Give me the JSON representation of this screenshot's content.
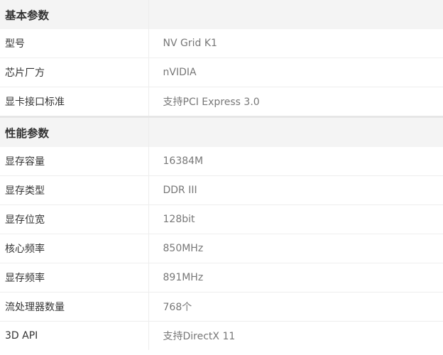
{
  "sections": [
    {
      "title": "基本参数",
      "rows": [
        {
          "label": "型号",
          "value": "NV Grid K1"
        },
        {
          "label": "芯片厂方",
          "value": "nVIDIA"
        },
        {
          "label": "显卡接口标准",
          "value": "支持PCI Express 3.0"
        }
      ]
    },
    {
      "title": "性能参数",
      "rows": [
        {
          "label": "显存容量",
          "value": "16384M"
        },
        {
          "label": "显存类型",
          "value": "DDR III"
        },
        {
          "label": "显存位宽",
          "value": "128bit"
        },
        {
          "label": "核心频率",
          "value": "850MHz"
        },
        {
          "label": "显存频率",
          "value": "891MHz"
        },
        {
          "label": "流处理器数量",
          "value": "768个"
        },
        {
          "label": "3D API",
          "value": "支持DirectX 11"
        }
      ]
    }
  ]
}
